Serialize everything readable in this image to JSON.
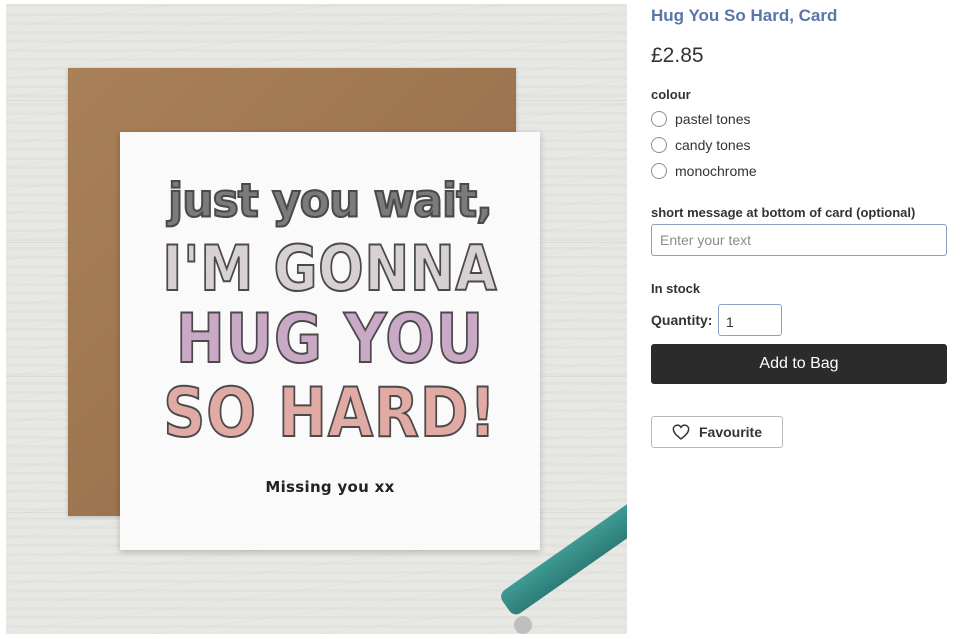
{
  "product": {
    "title": "Hug You So Hard, Card",
    "price": "£2.85",
    "image": {
      "alt": "Card reading just you wait, I'M GONNA HUG YOU SO HARD! Missing you xx",
      "card_lines": [
        "just you wait,",
        "I'M GONNA",
        "HUG YOU",
        "SO HARD!"
      ],
      "card_message": "Missing you xx"
    }
  },
  "options": {
    "colour_label": "colour",
    "colours": [
      {
        "label": "pastel tones"
      },
      {
        "label": "candy tones"
      },
      {
        "label": "monochrome"
      }
    ]
  },
  "message_field": {
    "label": "short message at bottom of card (optional)",
    "placeholder": "Enter your text",
    "value": ""
  },
  "stock_status": "In stock",
  "quantity": {
    "label": "Quantity:",
    "value": "1"
  },
  "actions": {
    "add_to_bag": "Add to Bag",
    "favourite": "Favourite",
    "favourite_icon": "heart-outline-icon"
  },
  "colors": {
    "title": "#5a76a8",
    "primary_button": "#2b2b2b",
    "input_border": "#8aa0c4"
  }
}
